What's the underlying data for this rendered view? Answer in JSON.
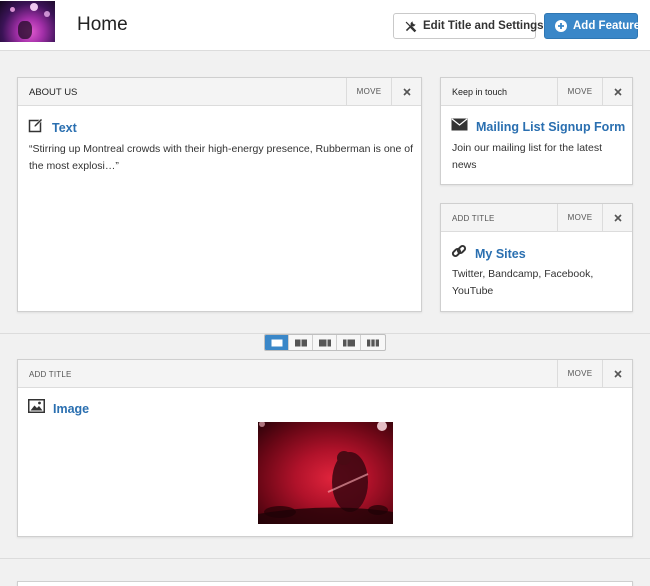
{
  "header": {
    "page_title": "Home",
    "edit_button_label": "Edit Title and Settings",
    "add_button_label": "Add Feature"
  },
  "about_panel": {
    "title": "ABOUT US",
    "move_label": "MOVE",
    "feature_name": "Text",
    "body": "“Stirring up Montreal crowds with their high-energy presence, Rubberman is one of the most explosi…”"
  },
  "keep_panel": {
    "title": "Keep in touch",
    "move_label": "MOVE",
    "feature_name": "Mailing List Signup Form",
    "body": "Join our mailing list for the latest news"
  },
  "sites_panel": {
    "title": "ADD TITLE",
    "move_label": "MOVE",
    "feature_name": "My Sites",
    "body": "Twitter, Bandcamp, Facebook, YouTube"
  },
  "image_panel": {
    "title": "ADD TITLE",
    "move_label": "MOVE",
    "feature_name": "Image"
  },
  "layout_options": [
    "one-column",
    "two-column",
    "two-column-wide-left",
    "two-column-wide-right",
    "three-column"
  ],
  "layout_selected": "one-column",
  "colors": {
    "accent": "#3a87c8",
    "link": "#2a6fb0",
    "panel_header": "#f4f4f4",
    "background": "#f1f1f1"
  },
  "icons": [
    "tools-icon",
    "plus-circle-icon",
    "close-icon",
    "edit-icon",
    "envelope-icon",
    "link-icon",
    "image-icon"
  ]
}
